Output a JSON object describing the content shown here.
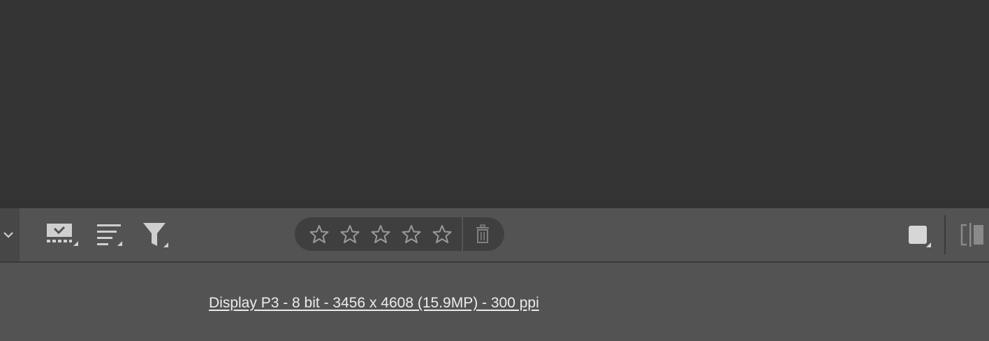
{
  "toolbar": {
    "collapse_icon": "chevron-down-icon",
    "tools": [
      {
        "name": "select-tool",
        "icon": "checkmark-filmstrip-icon"
      },
      {
        "name": "sort-tool",
        "icon": "sort-lines-icon"
      },
      {
        "name": "filter-tool",
        "icon": "funnel-icon"
      }
    ],
    "rating": {
      "stars_total": 5,
      "stars_selected": 0,
      "delete_icon": "trash-icon"
    },
    "right_tools": [
      {
        "name": "view-mode",
        "icon": "square-icon"
      },
      {
        "name": "compare",
        "icon": "split-view-icon"
      }
    ]
  },
  "info_bar": {
    "image_info": "Display P3 - 8 bit - 3456 x 4608 (15.9MP) - 300 ppi"
  },
  "colors": {
    "canvas": "#333333",
    "toolbar": "#535353",
    "pill": "#3f3f3f",
    "icon": "#cfcfcf",
    "star": "#9a9a9a",
    "text": "#ececec"
  }
}
